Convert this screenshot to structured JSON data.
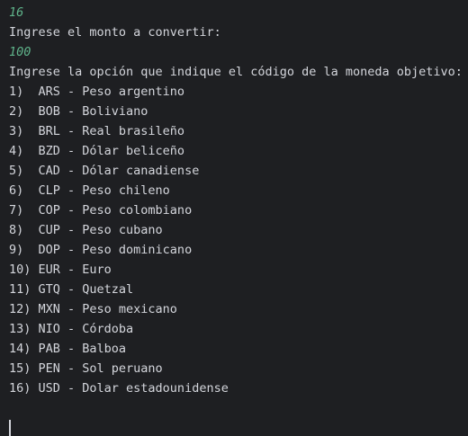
{
  "console": {
    "input_1": "16",
    "prompt_amount": "Ingrese el monto a convertir:",
    "input_2": "100",
    "prompt_currency": "Ingrese la opción que indique el código de la moneda objetivo:",
    "options": [
      "1)  ARS - Peso argentino",
      "2)  BOB - Boliviano",
      "3)  BRL - Real brasileño",
      "4)  BZD - Dólar beliceño",
      "5)  CAD - Dólar canadiense",
      "6)  CLP - Peso chileno",
      "7)  COP - Peso colombiano",
      "8)  CUP - Peso cubano",
      "9)  DOP - Peso dominicano",
      "10) EUR - Euro",
      "11) GTQ - Quetzal",
      "12) MXN - Peso mexicano",
      "13) NIO - Córdoba",
      "14) PAB - Balboa",
      "15) PEN - Sol peruano",
      "16) USD - Dolar estadounidense"
    ],
    "colors": {
      "background": "#1e1f22",
      "text": "#d4d6dc",
      "user_input": "#5fb38a"
    }
  }
}
